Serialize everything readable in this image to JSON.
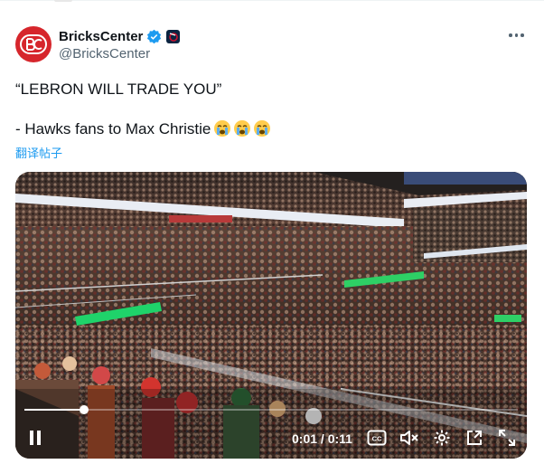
{
  "tweet": {
    "author": {
      "display_name": "BricksCenter",
      "handle": "@BricksCenter",
      "verified": true,
      "avatar_monogram": "BC",
      "brand_color": "#d6262c"
    },
    "text_lines": [
      "“LEBRON WILL TRADE YOU”",
      "",
      "- Hawks fans to Max Christie"
    ],
    "emojis": [
      "loudly-crying-face",
      "loudly-crying-face",
      "loudly-crying-face"
    ],
    "translate_label": "翻译帖子"
  },
  "video": {
    "time_display": "0:01 / 0:11",
    "progress": 0.12,
    "controls": [
      "pause-icon",
      "captions-icon",
      "mute-icon",
      "settings-icon",
      "pop-out-icon",
      "fullscreen-icon"
    ]
  },
  "colors": {
    "text": "#0f1419",
    "secondary": "#536471",
    "link": "#1d9bf0",
    "verified": "#1d9bf0"
  }
}
